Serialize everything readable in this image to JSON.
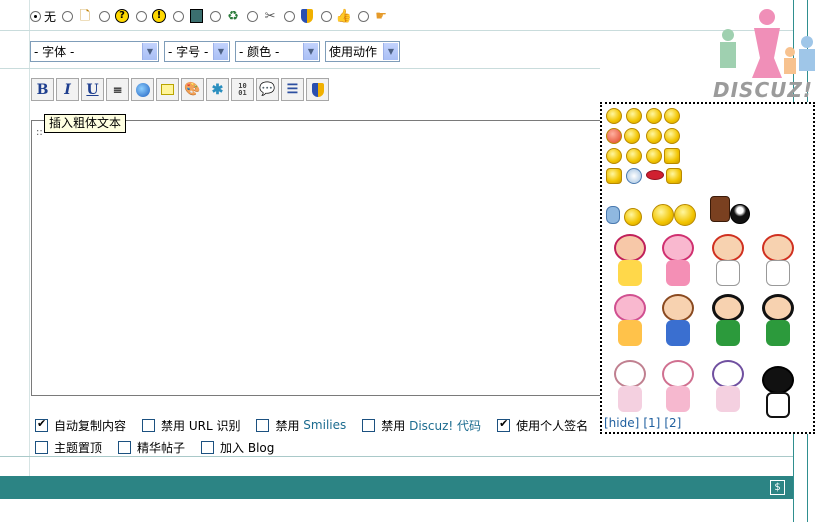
{
  "icon_row": {
    "none_label": "无",
    "icons": [
      "doc-icon",
      "question-icon",
      "exclamation-icon",
      "picture-icon",
      "refresh-icon",
      "tools-icon",
      "shield-icon",
      "thumb-icon",
      "pointing-hand-icon"
    ]
  },
  "toolbar_selects": {
    "font": "- 字体 -",
    "size": "- 字号 -",
    "color": "- 颜色 -",
    "action": "使用动作"
  },
  "toolbar": {
    "bold": "B",
    "italic": "I",
    "underline": "U"
  },
  "tooltip": "插入粗体文本",
  "editor": {
    "caret_text": "::"
  },
  "options": {
    "auto_copy": "自动复制内容",
    "disable_url_prefix": "禁用 URL 识别",
    "disable_smilies_prefix": "禁用",
    "disable_smilies_word": "Smilies",
    "disable_code_prefix": "禁用",
    "disable_code_word": "Discuz! 代码",
    "use_signature": "使用个人签名",
    "sticky": "主题置顶",
    "digest": "精华帖子",
    "add_blog": "加入 Blog"
  },
  "smilies_links": {
    "hide": "[hide]",
    "p1": "[1]",
    "p2": "[2]"
  },
  "logo": {
    "text": "DISCUZ!"
  },
  "bar": {
    "icon": "$"
  },
  "colors": {
    "teal": "#2c8484",
    "tooltip_bg": "#ffffe1",
    "link": "#1b6b8f"
  }
}
